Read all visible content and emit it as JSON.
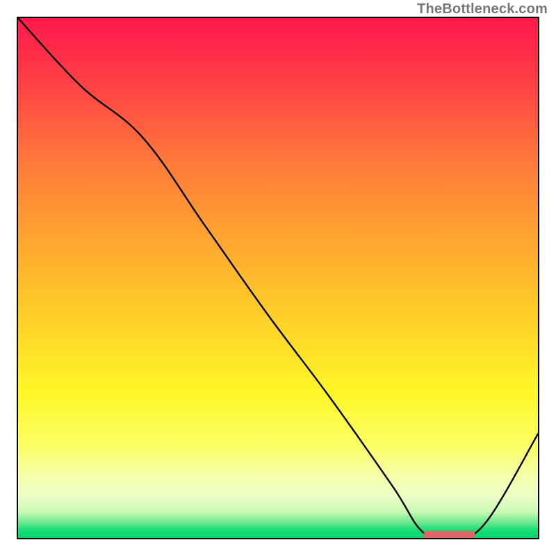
{
  "watermark": "TheBottleneck.com",
  "chart_data": {
    "type": "line",
    "title": "",
    "xlabel": "",
    "ylabel": "",
    "xlim": [
      0,
      100
    ],
    "ylim": [
      0,
      100
    ],
    "series": [
      {
        "name": "bottleneck-curve",
        "x": [
          0,
          12,
          24,
          36,
          48,
          60,
          72,
          78,
          84,
          90,
          100
        ],
        "y": [
          100,
          87,
          77,
          60,
          43,
          27,
          10,
          1,
          0,
          3,
          20
        ]
      }
    ],
    "annotations": [
      {
        "name": "optimal-range-marker",
        "x_start": 78,
        "x_end": 88,
        "y": 0.6,
        "color": "#e06666"
      }
    ],
    "gradient_stops": [
      {
        "pos": 0,
        "color": "#ff1a4d"
      },
      {
        "pos": 0.28,
        "color": "#ff7a3a"
      },
      {
        "pos": 0.58,
        "color": "#ffd028"
      },
      {
        "pos": 0.82,
        "color": "#fbff63"
      },
      {
        "pos": 0.95,
        "color": "#c7f9b4"
      },
      {
        "pos": 1.0,
        "color": "#04d46c"
      }
    ]
  }
}
